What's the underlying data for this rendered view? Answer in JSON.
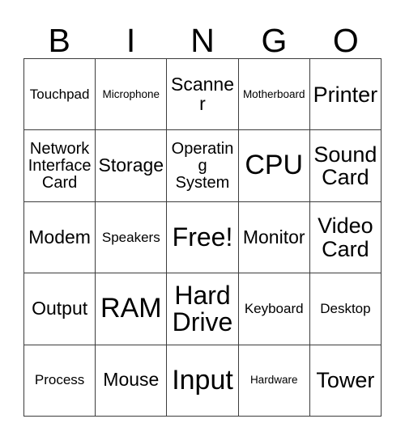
{
  "card": {
    "header_letters": [
      "B",
      "I",
      "N",
      "G",
      "O"
    ],
    "free_space_label": "Free!",
    "rows": [
      [
        {
          "label": "Touchpad",
          "size": "xs"
        },
        {
          "label": "Microphone",
          "size": "xxs"
        },
        {
          "label": "Scanner",
          "size": "md"
        },
        {
          "label": "Motherboard",
          "size": "xxs"
        },
        {
          "label": "Printer",
          "size": "lg"
        }
      ],
      [
        {
          "label": "Network Interface Card",
          "size": "sm"
        },
        {
          "label": "Storage",
          "size": "md"
        },
        {
          "label": "Operating System",
          "size": "sm"
        },
        {
          "label": "CPU",
          "size": "xxl"
        },
        {
          "label": "Sound Card",
          "size": "lg"
        }
      ],
      [
        {
          "label": "Modem",
          "size": "md"
        },
        {
          "label": "Speakers",
          "size": "xs"
        },
        {
          "label": "Free!",
          "size": "xl"
        },
        {
          "label": "Monitor",
          "size": "md"
        },
        {
          "label": "Video Card",
          "size": "lg"
        }
      ],
      [
        {
          "label": "Output",
          "size": "md"
        },
        {
          "label": "RAM",
          "size": "xxl"
        },
        {
          "label": "Hard Drive",
          "size": "xl"
        },
        {
          "label": "Keyboard",
          "size": "xs"
        },
        {
          "label": "Desktop",
          "size": "xs"
        }
      ],
      [
        {
          "label": "Process",
          "size": "xs"
        },
        {
          "label": "Mouse",
          "size": "md"
        },
        {
          "label": "Input",
          "size": "xxl"
        },
        {
          "label": "Hardware",
          "size": "xxs"
        },
        {
          "label": "Tower",
          "size": "lg"
        }
      ]
    ]
  },
  "colors": {
    "background": "#ffffff",
    "text": "#000000",
    "grid_line": "#3c3c3c"
  }
}
